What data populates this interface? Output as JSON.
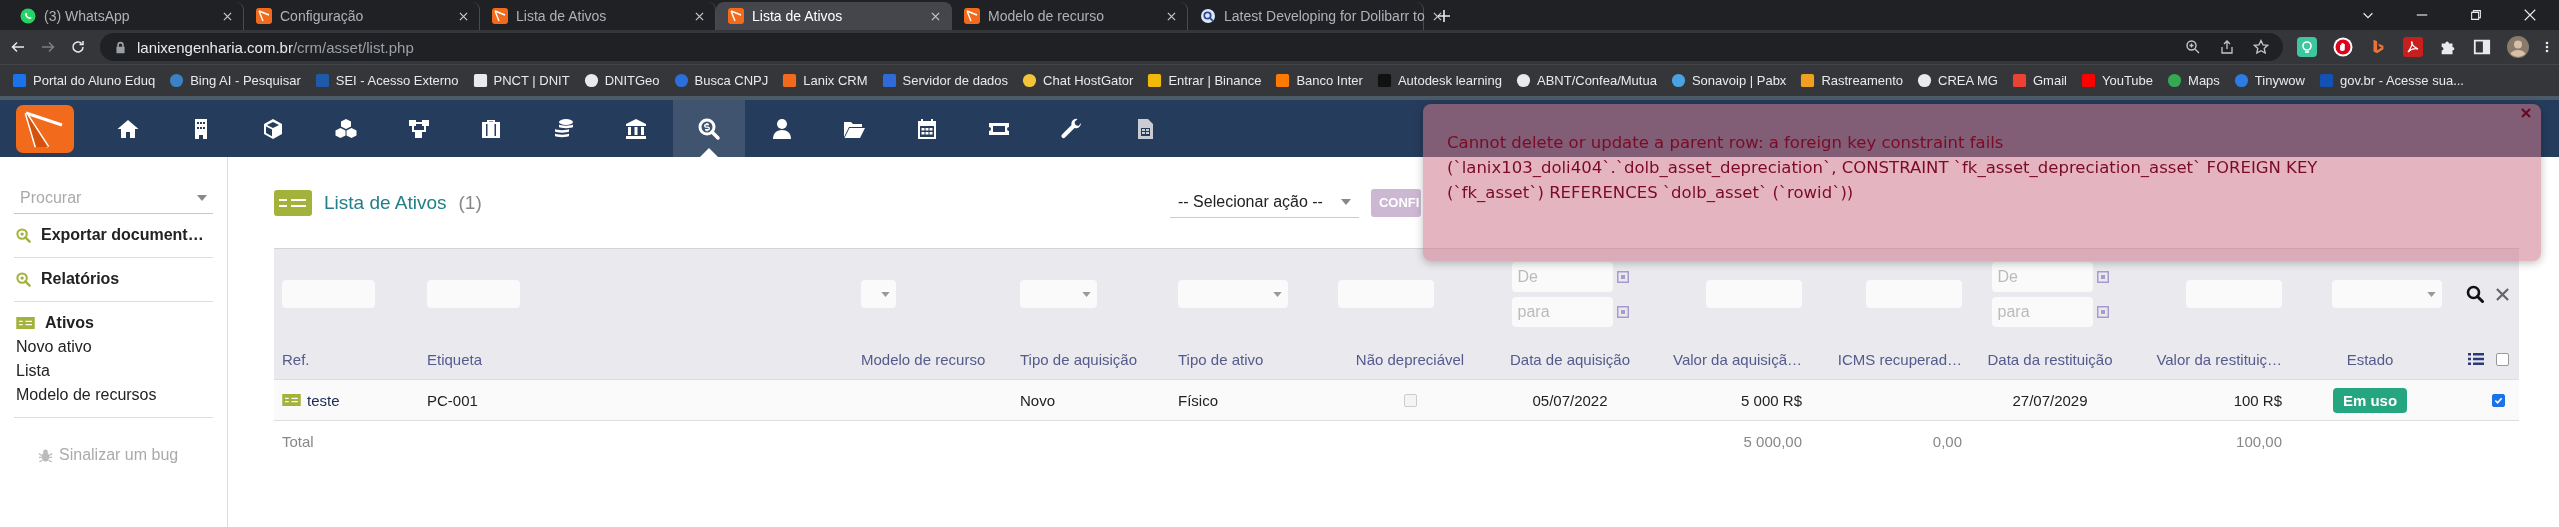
{
  "browser": {
    "tabs": [
      {
        "title": "(3) WhatsApp",
        "kind": "chat",
        "selected": false
      },
      {
        "title": "Configuração",
        "kind": "app",
        "selected": false
      },
      {
        "title": "Lista de Ativos",
        "kind": "app",
        "selected": false
      },
      {
        "title": "Lista de Ativos",
        "kind": "app",
        "selected": true
      },
      {
        "title": "Modelo de recurso",
        "kind": "app",
        "selected": false
      },
      {
        "title": "Latest Developing for Dolibarr to",
        "kind": "forum",
        "selected": false
      }
    ],
    "url": {
      "host": "lanixengenharia.com.br",
      "path": "/crm/asset/list.php"
    },
    "bookmarks": [
      {
        "label": "Portal do Aluno Eduq"
      },
      {
        "label": "Bing AI - Pesquisar"
      },
      {
        "label": "SEI - Acesso Externo"
      },
      {
        "label": "PNCT | DNIT"
      },
      {
        "label": "DNITGeo"
      },
      {
        "label": "Busca CNPJ"
      },
      {
        "label": "Lanix CRM"
      },
      {
        "label": "Servidor de dados"
      },
      {
        "label": "Chat HostGator"
      },
      {
        "label": "Entrar | Binance"
      },
      {
        "label": "Banco Inter"
      },
      {
        "label": "Autodesk learning"
      },
      {
        "label": "ABNT/Confea/Mutua"
      },
      {
        "label": "Sonavoip | Pabx"
      },
      {
        "label": "Rastreamento"
      },
      {
        "label": "CREA MG"
      },
      {
        "label": "Gmail"
      },
      {
        "label": "YouTube"
      },
      {
        "label": "Maps"
      },
      {
        "label": "Tinywow"
      },
      {
        "label": "gov.br - Acesse sua..."
      }
    ]
  },
  "topmenu": [
    {
      "selected": false
    },
    {
      "selected": false
    },
    {
      "selected": false
    },
    {
      "selected": false
    },
    {
      "selected": false
    },
    {
      "selected": false
    },
    {
      "selected": false
    },
    {
      "selected": false
    },
    {
      "selected": true
    },
    {
      "selected": false
    },
    {
      "selected": false
    },
    {
      "selected": false
    },
    {
      "selected": false
    },
    {
      "selected": false
    },
    {
      "selected": false
    }
  ],
  "sidebar": {
    "search": {
      "placeholder": "Procurar"
    },
    "sections": [
      {
        "title": "Exportar document…",
        "kind": "report"
      },
      {
        "title": "Relatórios",
        "kind": "report"
      },
      {
        "title": "Ativos",
        "kind": "asset",
        "items": [
          "Novo ativo",
          "Lista",
          "Modelo de recursos"
        ]
      }
    ],
    "bug_link": "Sinalizar um bug"
  },
  "list": {
    "title": "Lista de Ativos",
    "count": "(1)",
    "mass_action": {
      "value": "-- Selecionar ação --"
    },
    "confirm_button": "CONFI"
  },
  "table": {
    "filters": [
      {
        "kind": "text"
      },
      {
        "kind": "text"
      },
      {
        "kind": "select"
      },
      {
        "kind": "select"
      },
      {
        "kind": "select"
      },
      {
        "kind": "text"
      },
      {
        "kind": "date-range",
        "placeholder_from": "De",
        "placeholder_to": "para"
      },
      {
        "kind": "text"
      },
      {
        "kind": "text"
      },
      {
        "kind": "date-range",
        "placeholder_from": "De",
        "placeholder_to": "para"
      },
      {
        "kind": "text"
      },
      {
        "kind": "select"
      }
    ],
    "columns": [
      "Ref.",
      "Etiqueta",
      "Modelo de recurso",
      "Tipo de aquisição",
      "Tipo de ativo",
      "Não depreciável",
      "Data de aquisição",
      "Valor da aquisiçã…",
      "ICMS recuperad…",
      "Data da restituição",
      "Valor da restituiç…",
      "Estado"
    ],
    "select_all": {
      "checked": false
    },
    "rows": [
      {
        "checked": true,
        "cells": [
          {
            "kind": "ref",
            "text": "teste"
          },
          {
            "kind": "text",
            "text": "PC-001"
          },
          {
            "kind": "empty"
          },
          {
            "kind": "text",
            "text": "Novo"
          },
          {
            "kind": "text",
            "text": "Físico"
          },
          {
            "kind": "checkbox",
            "checked": false,
            "disabled": true
          },
          {
            "kind": "text",
            "text": "05/07/2022"
          },
          {
            "kind": "text",
            "text": "5 000 R$"
          },
          {
            "kind": "empty"
          },
          {
            "kind": "text",
            "text": "27/07/2029"
          },
          {
            "kind": "text",
            "text": "100 R$"
          },
          {
            "kind": "badge",
            "text": "Em uso"
          }
        ]
      }
    ],
    "totals": [
      {
        "kind": "label",
        "text": "Total"
      },
      {
        "kind": "empty"
      },
      {
        "kind": "empty"
      },
      {
        "kind": "empty"
      },
      {
        "kind": "empty"
      },
      {
        "kind": "empty"
      },
      {
        "kind": "empty"
      },
      {
        "kind": "value",
        "text": "5 000,00"
      },
      {
        "kind": "value",
        "text": "0,00"
      },
      {
        "kind": "empty"
      },
      {
        "kind": "value",
        "text": "100,00"
      },
      {
        "kind": "empty"
      }
    ]
  },
  "error": {
    "lines": [
      "Cannot delete or update a parent row: a foreign key constraint fails",
      "(`lanix103_doli404`.`dolb_asset_depreciation`, CONSTRAINT `fk_asset_depreciation_asset` FOREIGN KEY",
      "(`fk_asset`) REFERENCES `dolb_asset` (`rowid`))"
    ]
  }
}
